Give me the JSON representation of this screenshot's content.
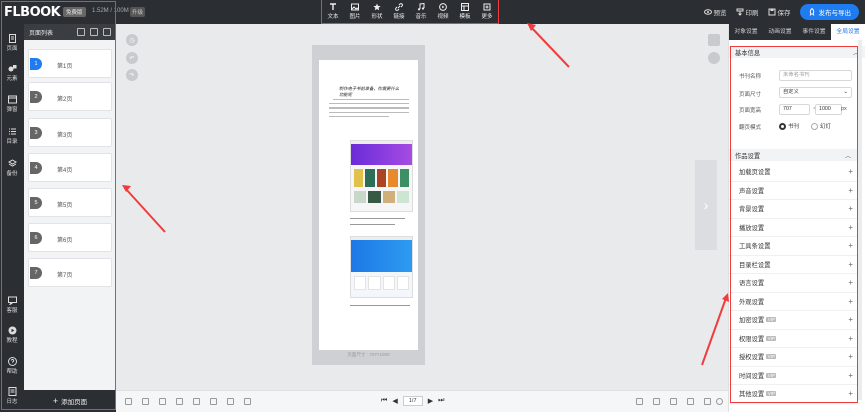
{
  "app": {
    "logo": "FLBOOK",
    "badge": "免费版",
    "storage": "1.52M / 100M",
    "tag": "升级"
  },
  "toolbar": [
    {
      "id": "text",
      "label": "文本"
    },
    {
      "id": "image",
      "label": "图片"
    },
    {
      "id": "shape",
      "label": "形状"
    },
    {
      "id": "link",
      "label": "链接"
    },
    {
      "id": "music",
      "label": "音乐"
    },
    {
      "id": "video",
      "label": "视频"
    },
    {
      "id": "template",
      "label": "模板"
    },
    {
      "id": "more",
      "label": "更多"
    }
  ],
  "topright": {
    "preview": "预览",
    "print": "印刷",
    "save": "保存",
    "publish": "发布与导出"
  },
  "nav": [
    {
      "id": "page",
      "label": "页面"
    },
    {
      "id": "element",
      "label": "元素"
    },
    {
      "id": "popup",
      "label": "弹窗"
    },
    {
      "id": "toc",
      "label": "目录"
    },
    {
      "id": "backup",
      "label": "备份"
    },
    {
      "id": "feedback",
      "label": "客服"
    },
    {
      "id": "tutorial",
      "label": "教程"
    },
    {
      "id": "help",
      "label": "帮助"
    },
    {
      "id": "log",
      "label": "日志"
    }
  ],
  "pages": {
    "title": "页面列表",
    "items": [
      {
        "num": "1",
        "label": "第1页"
      },
      {
        "num": "2",
        "label": "第2页"
      },
      {
        "num": "3",
        "label": "第3页"
      },
      {
        "num": "4",
        "label": "第4页"
      },
      {
        "num": "5",
        "label": "第5页"
      },
      {
        "num": "6",
        "label": "第6页"
      },
      {
        "num": "7",
        "label": "第7页"
      }
    ],
    "add": "添加页面"
  },
  "doc": {
    "heading": "制作电子书前准备，你需要什么功能呢",
    "footer": "页面尺寸 · 707×1000"
  },
  "pager": {
    "current": "1/7"
  },
  "right": {
    "tabs": [
      "对象设置",
      "动画设置",
      "事件设置",
      "全局设置"
    ],
    "basic": {
      "title": "基本信息",
      "name_label": "书刊名称",
      "name_placeholder": "未命名书刊",
      "size_label": "页面尺寸",
      "size_value": "自定义",
      "dim_label": "页面宽高",
      "width": "707",
      "height": "1000",
      "unit": "px",
      "mode_label": "翻页模式",
      "mode_book": "书刊",
      "mode_slide": "幻灯"
    },
    "works": {
      "title": "作品设置",
      "items": [
        {
          "label": "加载页设置",
          "vip": ""
        },
        {
          "label": "声音设置",
          "vip": ""
        },
        {
          "label": "背景设置",
          "vip": ""
        },
        {
          "label": "播放设置",
          "vip": ""
        },
        {
          "label": "工具条设置",
          "vip": ""
        },
        {
          "label": "目录栏设置",
          "vip": ""
        },
        {
          "label": "语言设置",
          "vip": ""
        },
        {
          "label": "外观设置",
          "vip": ""
        },
        {
          "label": "加密设置",
          "vip": "VIP"
        },
        {
          "label": "权限设置",
          "vip": "VIP"
        },
        {
          "label": "授权设置",
          "vip": "VIP"
        },
        {
          "label": "时间设置",
          "vip": "VIP"
        },
        {
          "label": "其他设置",
          "vip": "VIP"
        }
      ]
    }
  }
}
